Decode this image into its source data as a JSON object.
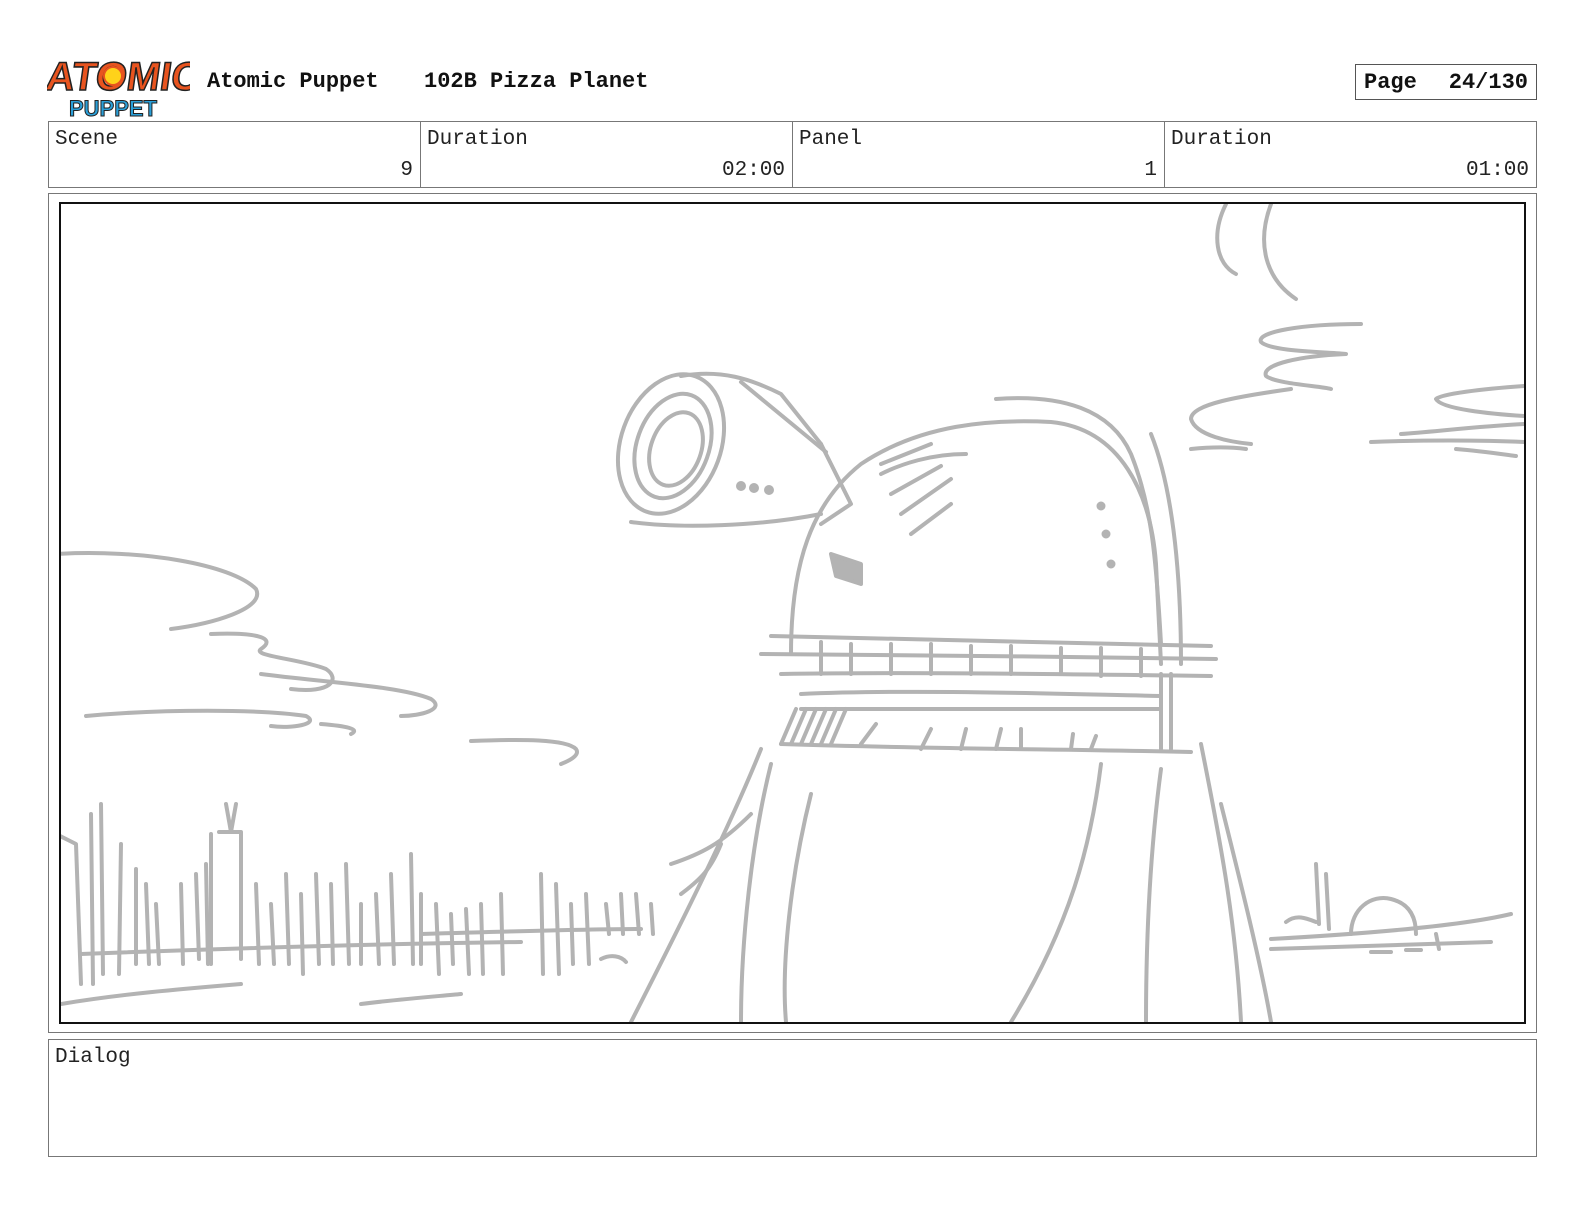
{
  "header": {
    "logo_text_top": "ATOMIC",
    "logo_text_bottom": "PUPPET",
    "show_title": "Atomic Puppet",
    "episode_title": "102B Pizza Planet",
    "page_label": "Page",
    "page_number": "24/130"
  },
  "info": {
    "scene_label": "Scene",
    "scene_value": "9",
    "scene_duration_label": "Duration",
    "scene_duration_value": "02:00",
    "panel_label": "Panel",
    "panel_value": "1",
    "panel_duration_label": "Duration",
    "panel_duration_value": "01:00"
  },
  "dialog": {
    "label": "Dialog",
    "text": ""
  },
  "colors": {
    "sketch": "#b3b3b3",
    "logo_orange": "#e8541f",
    "logo_blue": "#2a9fd8",
    "logo_yellow": "#ffd21a",
    "frame": "#111111"
  }
}
